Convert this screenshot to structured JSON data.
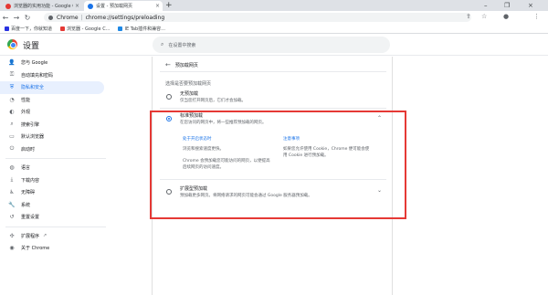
{
  "tabs": [
    {
      "title": "浏览器的实用功能 - Google Ch...",
      "icon": "red-icon",
      "active": false
    },
    {
      "title": "设置 - 预加载网页",
      "icon": "gear-icon",
      "active": true
    }
  ],
  "toolbar": {
    "url_host": "Chrome",
    "url_sep": "|",
    "url_path": "chrome://settings/preloading"
  },
  "bookmarks": [
    {
      "label": "百度一下，你就知道"
    },
    {
      "label": "浏览器 - Google C..."
    },
    {
      "label": "IE Tab插件和兼容..."
    }
  ],
  "header": {
    "title": "设置",
    "search_placeholder": "在设置中搜索"
  },
  "sidebar": {
    "items": [
      {
        "label": "您与 Google",
        "icon": "person-icon"
      },
      {
        "label": "自动填充和密码",
        "icon": "key-icon"
      },
      {
        "label": "隐私和安全",
        "icon": "shield-icon",
        "selected": true
      },
      {
        "label": "性能",
        "icon": "speed-icon"
      },
      {
        "label": "外观",
        "icon": "palette-icon"
      },
      {
        "label": "搜索引擎",
        "icon": "search-icon"
      },
      {
        "label": "默认浏览器",
        "icon": "browser-icon"
      },
      {
        "label": "启动时",
        "icon": "power-icon"
      },
      {
        "label": "语言",
        "icon": "globe-icon"
      },
      {
        "label": "下载内容",
        "icon": "download-icon"
      },
      {
        "label": "无障碍",
        "icon": "accessibility-icon"
      },
      {
        "label": "系统",
        "icon": "wrench-icon"
      },
      {
        "label": "重置设置",
        "icon": "reset-icon"
      },
      {
        "label": "扩展程序",
        "icon": "puzzle-icon"
      },
      {
        "label": "关于 Chrome",
        "icon": "chrome-icon"
      }
    ]
  },
  "main": {
    "back_title": "预加载网页",
    "section_heading": "选择是否要预加载网页",
    "options": [
      {
        "title": "无预加载",
        "subtitle": "仅当您打开网页后，它们才会加载。"
      },
      {
        "title": "标准预加载",
        "subtitle": "在您访问的网页中，将一些推荐预加载的网页。",
        "when_on_heading": "处于开启状态时",
        "when_on_1": "浏览和搜索速度更快。",
        "when_on_2": "Chrome 会预加载您可能访问的网页，以便提高后续网页的访问速度。",
        "notes_heading": "注意事项",
        "notes_1": "如果您允许使用 Cookie，Chrome 便可能会使用 Cookie 进行预加载。"
      },
      {
        "title": "扩展型预加载",
        "subtitle": "预加载更多网页。将网络请求的网页可能会通过 Google 服务器预加载。"
      }
    ]
  },
  "colors": {
    "accent": "#1a73e8",
    "highlight_box": "#e53935"
  }
}
